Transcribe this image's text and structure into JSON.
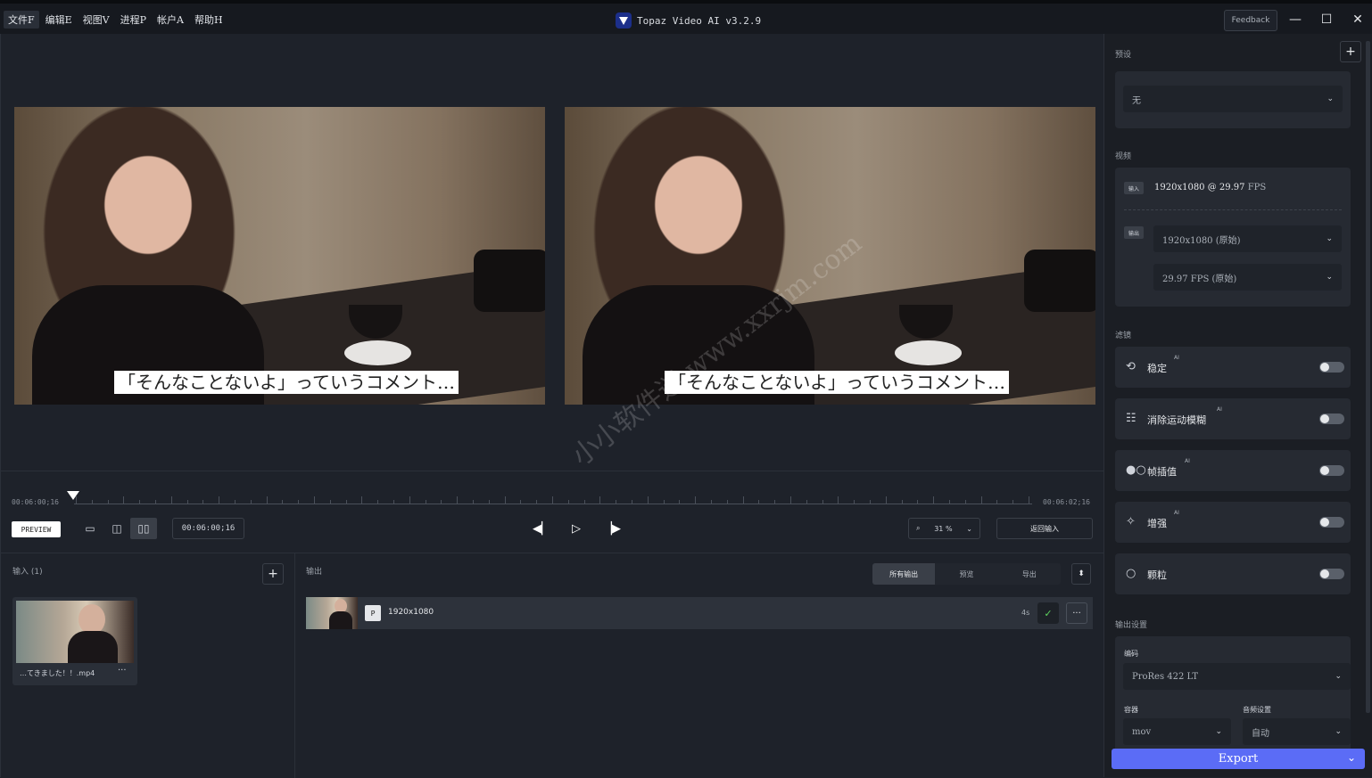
{
  "menu": [
    "文件F",
    "编辑E",
    "视图V",
    "进程P",
    "帐户A",
    "帮助H"
  ],
  "app_title": "Topaz Video AI  v3.2.9",
  "feedback_label": "Feedback",
  "window_controls": {
    "minimize": "—",
    "maximize": "☐",
    "close": "✕"
  },
  "subtitle_text": "「そんなことないよ」っていうコメント…",
  "timeline": {
    "start": "00:06:00;16",
    "end": "00:06:02;16"
  },
  "controls": {
    "preview_label": "PREVIEW",
    "current_time": "00:06:00;16",
    "zoom": "31 %",
    "return_label": "返回输入"
  },
  "input_panel": {
    "title": "输入 (1)",
    "add": "+",
    "file_name": "…てきました！！.mp4",
    "more": "···"
  },
  "output_panel": {
    "title": "输出",
    "filters": [
      "所有输出",
      "预览",
      "导出"
    ],
    "sort": "⬍",
    "row": {
      "badge": "P",
      "resolution": "1920x1080",
      "duration": "4s",
      "check": "✓",
      "more": "···"
    }
  },
  "sidebar": {
    "preset_title": "预设",
    "preset_add": "+",
    "preset_value": "无",
    "video_title": "视频",
    "input_tag": "输入",
    "input_spec_main": "1920x1080 @ 29.97",
    "input_spec_unit": "FPS",
    "output_tag": "输出",
    "output_resolution": "1920x1080 (原始)",
    "output_fps": "29.97 FPS (原始)",
    "filters_title": "滤镜",
    "filters": [
      {
        "icon": "stabilize-icon",
        "glyph": "⟲",
        "label": "稳定",
        "ai": "AI"
      },
      {
        "icon": "motion-deblur-icon",
        "glyph": "☷",
        "label": "消除运动模糊",
        "ai": "AI"
      },
      {
        "icon": "frame-interpolation-icon",
        "glyph": "●○",
        "label": "帧插值",
        "ai": "AI"
      },
      {
        "icon": "enhance-icon",
        "glyph": "✧",
        "label": "增强",
        "ai": "AI"
      },
      {
        "icon": "grain-icon",
        "glyph": "○",
        "label": "颗粒",
        "ai": ""
      }
    ],
    "output_settings_title": "输出设置",
    "codec_label": "编码",
    "codec_value": "ProRes 422 LT",
    "container_label": "容器",
    "container_value": "mov",
    "audio_label": "音频设置",
    "audio_value": "自动",
    "export_label": "Export"
  },
  "watermark": "小小软件迷 www.xxrjm.com",
  "colors": {
    "accent": "#5b6cf6",
    "background": "#1e222a",
    "panel": "#262a32"
  }
}
